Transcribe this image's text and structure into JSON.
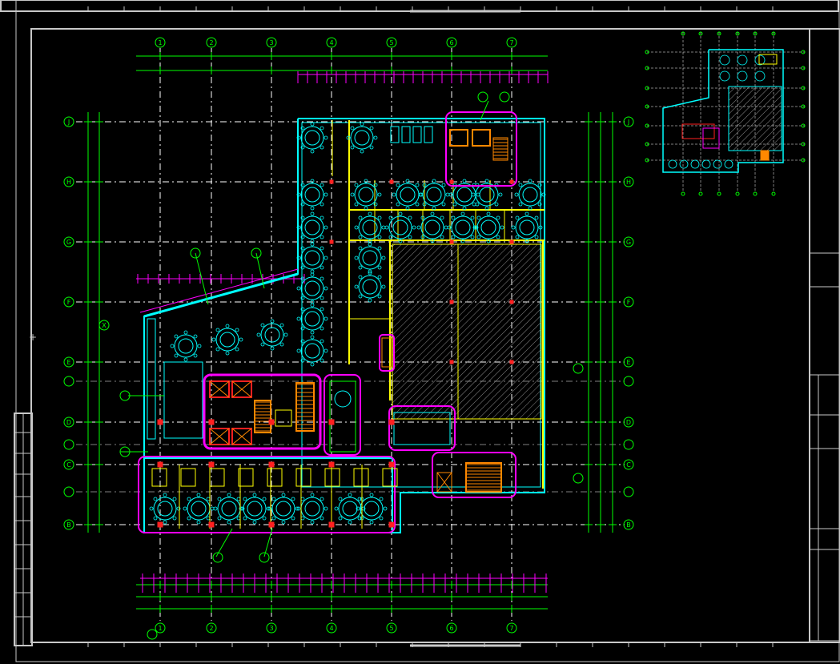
{
  "drawing": {
    "colors": {
      "background": "#000000",
      "frame": "#c8c8c8",
      "grid": "#ffffff",
      "dimension": "#00ff00",
      "magenta": "#ff00ff",
      "cyan": "#00ffff",
      "yellow": "#ffff00",
      "red": "#ff2020",
      "orange": "#ff8800",
      "hatch": "#8a8a8a"
    },
    "column_labels": [
      "1",
      "2",
      "3",
      "4",
      "5",
      "6",
      "7"
    ],
    "row_labels": [
      "J",
      "H",
      "G",
      "F",
      "E",
      "D",
      "C",
      "B"
    ],
    "intermediate_rows": [
      "X"
    ]
  }
}
